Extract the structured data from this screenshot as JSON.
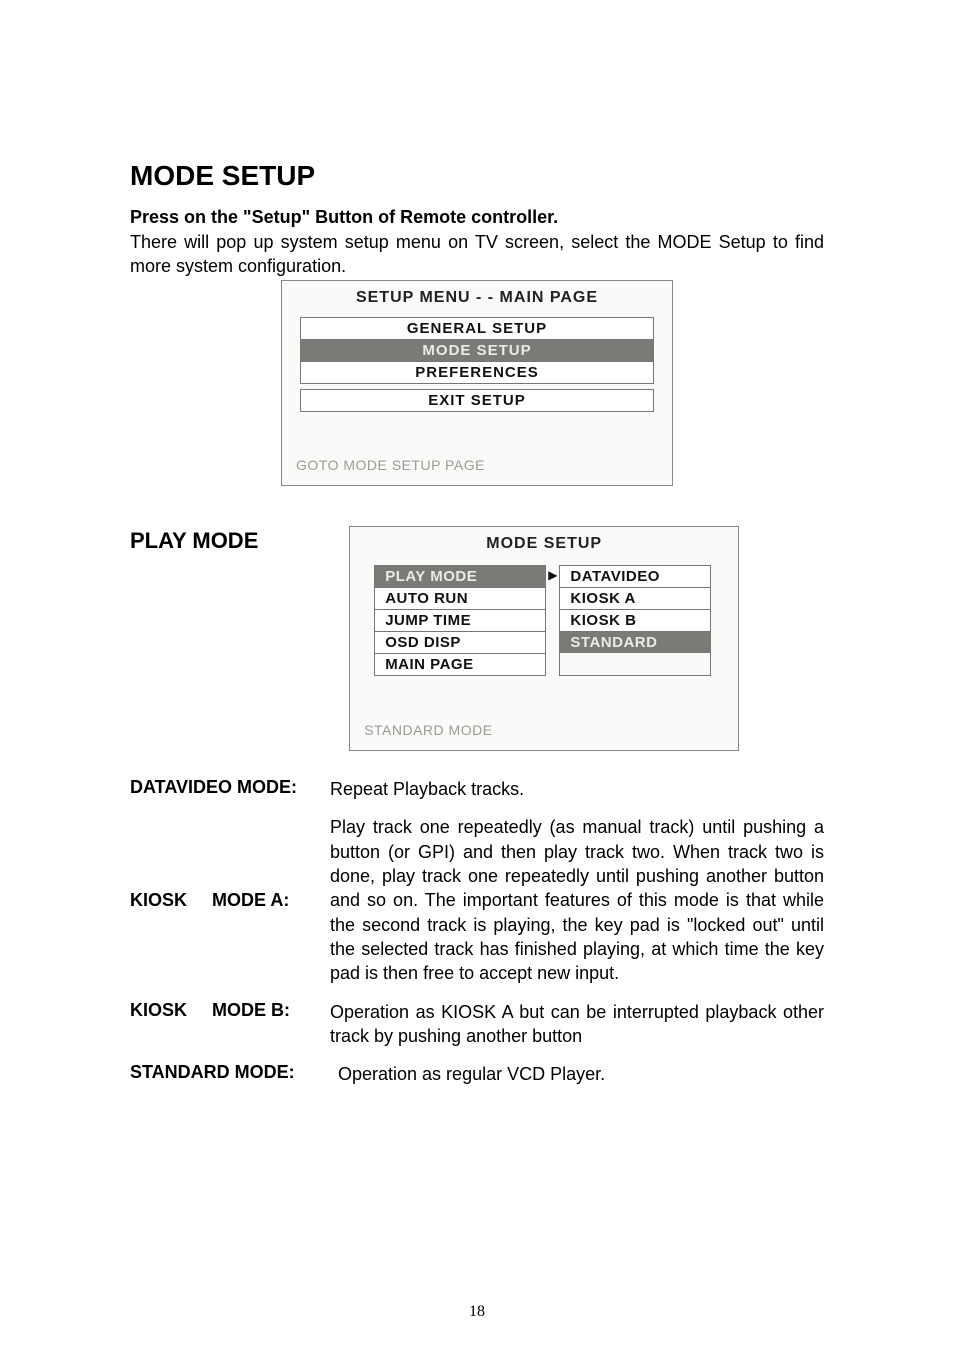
{
  "heading": "MODE   SETUP",
  "intro_bold": "Press on the \"Setup\" Button of Remote controller.",
  "intro_text": "There will pop up system setup menu on TV screen, select the MODE Setup to find more system configuration.",
  "main_menu": {
    "title": "SETUP MENU  - -  MAIN PAGE",
    "items": [
      "GENERAL SETUP",
      "MODE SETUP",
      "PREFERENCES"
    ],
    "exit": "EXIT SETUP",
    "hint": "GOTO MODE SETUP PAGE"
  },
  "play_mode_heading": "PLAY MODE",
  "mode_menu": {
    "title": "MODE SETUP",
    "left": [
      "PLAY MODE",
      "AUTO RUN",
      "JUMP TIME",
      "OSD DISP",
      "MAIN PAGE"
    ],
    "right": [
      "DATAVIDEO",
      "KIOSK A",
      "KIOSK B",
      "STANDARD"
    ],
    "hint": "STANDARD MODE"
  },
  "defs": {
    "datavideo": {
      "term": "DATAVIDEO MODE:",
      "desc": "Repeat Playback tracks."
    },
    "kiosk_a": {
      "term": "KIOSK     MODE A:",
      "desc": "Play track one repeatedly (as manual track) until pushing a button (or GPI) and then play track two. When track two is done, play track one repeatedly until pushing another button and so on. The important features of this mode is that while the second track is playing, the key pad is \"locked out\" until the selected track has finished playing, at which time the key pad is then free to accept new input."
    },
    "kiosk_b": {
      "term": "KIOSK     MODE B:",
      "desc": "Operation as KIOSK A but can be interrupted playback other track by pushing another button"
    },
    "standard": {
      "term": "STANDARD MODE:",
      "desc": "Operation as regular VCD Player."
    }
  },
  "page_number": "18"
}
